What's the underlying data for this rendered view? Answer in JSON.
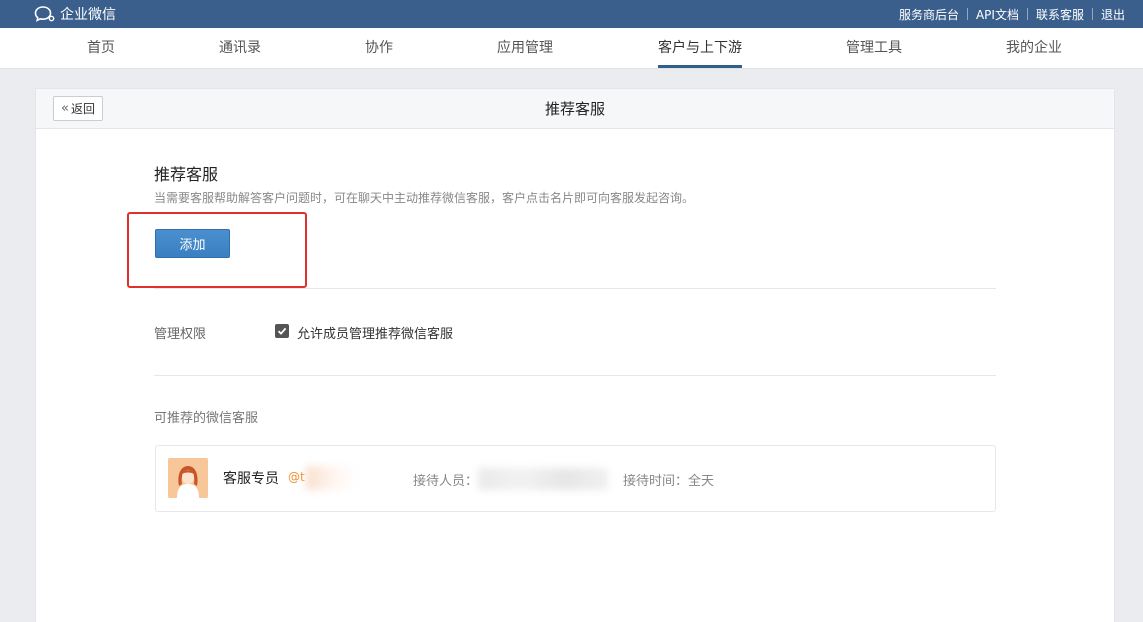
{
  "topbar": {
    "logo_text": "企业微信",
    "links": [
      "服务商后台",
      "API文档",
      "联系客服",
      "退出"
    ]
  },
  "nav": {
    "items": [
      "首页",
      "通讯录",
      "协作",
      "应用管理",
      "客户与上下游",
      "管理工具",
      "我的企业"
    ],
    "active": "客户与上下游"
  },
  "header": {
    "back_label": "返回",
    "title": "推荐客服"
  },
  "main": {
    "section_title": "推荐客服",
    "description": "当需要客服帮助解答客户问题时，可在聊天中主动推荐微信客服，客户点击名片即可向客服发起咨询。",
    "add_label": "添加",
    "permission": {
      "label": "管理权限",
      "checkbox_label": "允许成员管理推荐微信客服",
      "checked": true
    },
    "list_title": "可推荐的微信客服",
    "list": [
      {
        "name": "客服专员",
        "corp": "@t",
        "receiver_label": "接待人员：",
        "time_label": "接待时间：全天"
      }
    ]
  },
  "colors": {
    "topbar": "#3b5f8c",
    "primary_button": "#3a7fc0",
    "highlight": "#e0302b",
    "corp_tag": "#f0902e"
  }
}
